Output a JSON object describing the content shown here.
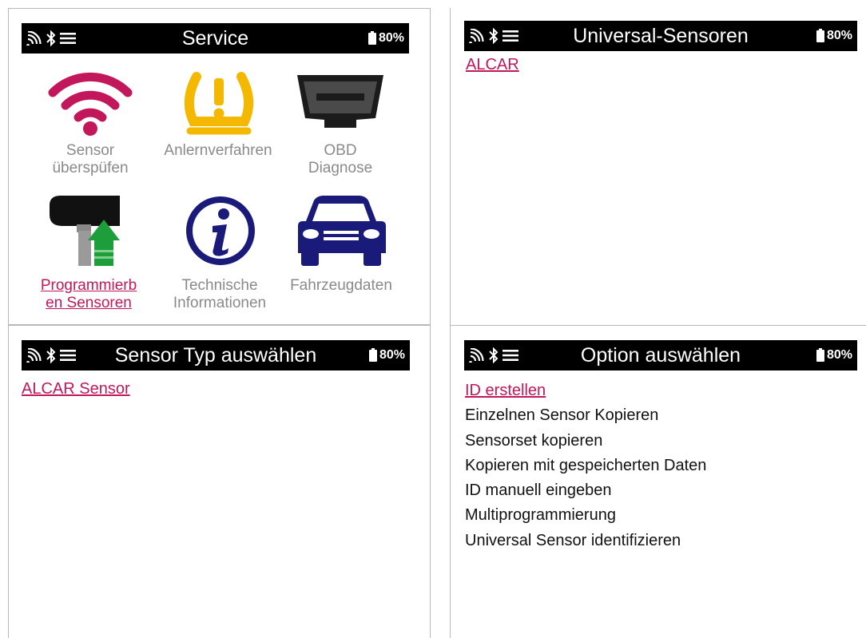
{
  "status": {
    "battery": "80%",
    "icons": [
      "signal-icon",
      "bluetooth-icon",
      "menu-icon"
    ]
  },
  "panels": {
    "service": {
      "title": "Service",
      "tiles": [
        {
          "label_line1": "Sensor",
          "label_line2": "überspüfen",
          "icon": "wifi-icon",
          "active": false
        },
        {
          "label_line1": "Anlernverfahren",
          "label_line2": "",
          "icon": "tpms-warning-icon",
          "active": false
        },
        {
          "label_line1": "OBD",
          "label_line2": "Diagnose",
          "icon": "obd-connector-icon",
          "active": false
        },
        {
          "label_line1": "Programmierb",
          "label_line2": "en Sensoren",
          "icon": "sensor-program-icon",
          "active": true
        },
        {
          "label_line1": "Technische",
          "label_line2": "Informationen",
          "icon": "info-icon",
          "active": false
        },
        {
          "label_line1": "Fahrzeugdaten",
          "label_line2": "",
          "icon": "car-icon",
          "active": false
        }
      ]
    },
    "universal": {
      "title": "Universal-Sensoren",
      "items": [
        "ALCAR"
      ]
    },
    "sensor_type": {
      "title": "Sensor Typ auswählen",
      "items": [
        "ALCAR Sensor"
      ]
    },
    "option": {
      "title": "Option auswählen",
      "selected": "ID erstellen",
      "items": [
        "Einzelnen Sensor Kopieren",
        "Sensorset kopieren",
        "Kopieren mit gespeicherten Daten",
        "ID manuell eingeben",
        "Multiprogrammierung",
        "Universal Sensor identifizieren"
      ]
    }
  },
  "colors": {
    "accent": "#c2185b",
    "icon_blue": "#1a1a7a",
    "icon_yellow": "#f5b800",
    "icon_green": "#1e9e3a"
  }
}
